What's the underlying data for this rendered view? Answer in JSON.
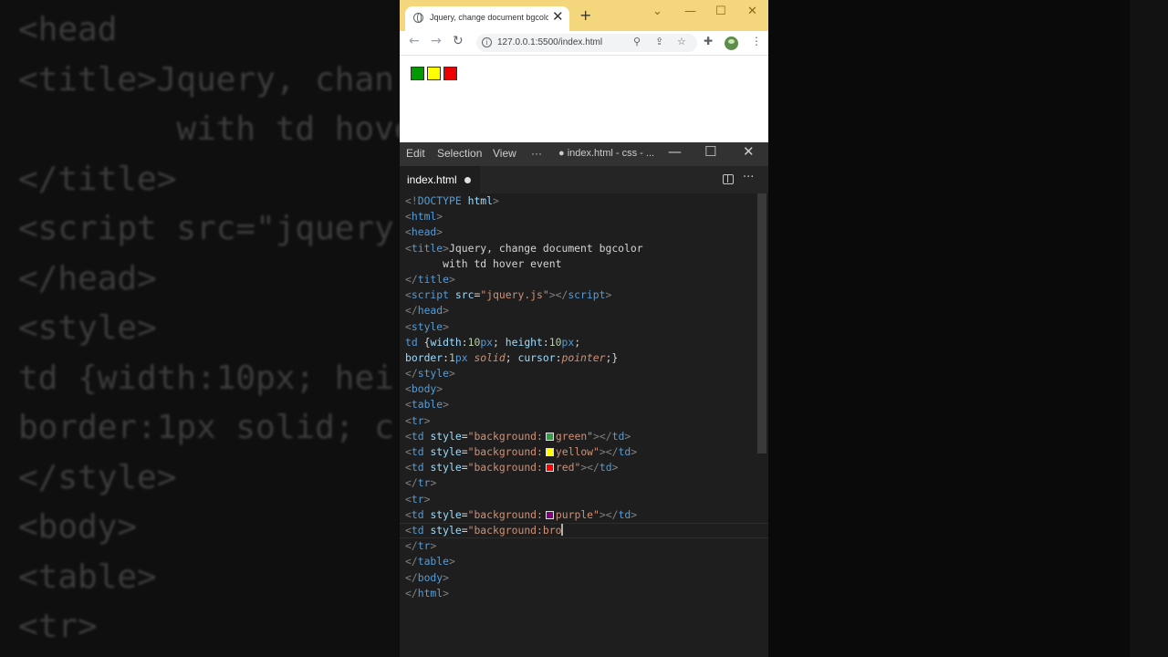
{
  "background_code": {
    "lines": [
      "<head",
      "<title>Jquery, chan",
      "        with td hove",
      "</title>",
      "<script src=\"jquery",
      "</head>",
      "<style>",
      "td {width:10px; hei",
      "border:1px solid; c",
      "</style>",
      "<body>",
      "<table>",
      "<tr>"
    ]
  },
  "browser": {
    "tab_title": "Jquery, change document bgcolo",
    "tab_close": "✕",
    "new_tab": "+",
    "url": "127.0.0.1:5500/index.html",
    "cells": [
      {
        "color": "#009900"
      },
      {
        "color": "#ffff00"
      },
      {
        "color": "#ee0000"
      }
    ]
  },
  "vscode": {
    "menu": {
      "edit": "Edit",
      "selection": "Selection",
      "view": "View",
      "more": "···"
    },
    "window_title": "● index.html - css - ...",
    "tab": {
      "name": "index.html"
    },
    "code": [
      {
        "indent": "",
        "toks": [
          [
            "tg",
            "<!"
          ],
          [
            "tn",
            "DOCTYPE"
          ],
          [
            "tx",
            " "
          ],
          [
            "at",
            "html"
          ],
          [
            "tg",
            ">"
          ]
        ]
      },
      {
        "indent": "",
        "toks": [
          [
            "tg",
            "<"
          ],
          [
            "tn",
            "html"
          ],
          [
            "tg",
            ">"
          ]
        ]
      },
      {
        "indent": "",
        "toks": [
          [
            "tg",
            "<"
          ],
          [
            "tn",
            "head"
          ],
          [
            "tg",
            ">"
          ]
        ]
      },
      {
        "indent": "",
        "toks": [
          [
            "tg",
            "<"
          ],
          [
            "tn",
            "title"
          ],
          [
            "tg",
            ">"
          ],
          [
            "tx",
            "Jquery, change document bgcolor"
          ]
        ]
      },
      {
        "indent": "      ",
        "toks": [
          [
            "tx",
            "with td hover event"
          ]
        ]
      },
      {
        "indent": "",
        "toks": [
          [
            "tg",
            "</"
          ],
          [
            "tn",
            "title"
          ],
          [
            "tg",
            ">"
          ]
        ]
      },
      {
        "indent": "",
        "toks": [
          [
            "tg",
            "<"
          ],
          [
            "tn",
            "script"
          ],
          [
            "tx",
            " "
          ],
          [
            "at",
            "src"
          ],
          [
            "tx",
            "="
          ],
          [
            "st",
            "\"jquery.js\""
          ],
          [
            "tg",
            "></"
          ],
          [
            "tn",
            "script"
          ],
          [
            "tg",
            ">"
          ]
        ]
      },
      {
        "indent": "",
        "toks": [
          [
            "tg",
            "</"
          ],
          [
            "tn",
            "head"
          ],
          [
            "tg",
            ">"
          ]
        ]
      },
      {
        "indent": "",
        "toks": [
          [
            "tg",
            "<"
          ],
          [
            "tn",
            "style"
          ],
          [
            "tg",
            ">"
          ]
        ]
      },
      {
        "indent": "",
        "toks": [
          [
            "tn",
            "td"
          ],
          [
            "tx",
            " {"
          ],
          [
            "pr",
            "width"
          ],
          [
            "tx",
            ":"
          ],
          [
            "nm",
            "10"
          ],
          [
            "un",
            "px"
          ],
          [
            "tx",
            "; "
          ],
          [
            "pr",
            "height"
          ],
          [
            "tx",
            ":"
          ],
          [
            "nm",
            "10"
          ],
          [
            "un",
            "px"
          ],
          [
            "tx",
            ";"
          ]
        ]
      },
      {
        "indent": "",
        "toks": [
          [
            "pr",
            "border"
          ],
          [
            "tx",
            ":"
          ],
          [
            "nm",
            "1"
          ],
          [
            "un",
            "px"
          ],
          [
            "tx",
            " "
          ],
          [
            "kw",
            "solid"
          ],
          [
            "tx",
            "; "
          ],
          [
            "pr",
            "cursor"
          ],
          [
            "tx",
            ":"
          ],
          [
            "kw",
            "pointer"
          ],
          [
            "tx",
            ";}"
          ]
        ]
      },
      {
        "indent": "",
        "toks": [
          [
            "tg",
            "</"
          ],
          [
            "tn",
            "style"
          ],
          [
            "tg",
            ">"
          ]
        ]
      },
      {
        "indent": "",
        "toks": [
          [
            "tg",
            "<"
          ],
          [
            "tn",
            "body"
          ],
          [
            "tg",
            ">"
          ]
        ]
      },
      {
        "indent": "",
        "toks": [
          [
            "tg",
            "<"
          ],
          [
            "tn",
            "table"
          ],
          [
            "tg",
            ">"
          ]
        ]
      },
      {
        "indent": "",
        "toks": [
          [
            "tg",
            "<"
          ],
          [
            "tn",
            "tr"
          ],
          [
            "tg",
            ">"
          ]
        ]
      },
      {
        "indent": "",
        "toks": [
          [
            "tg",
            "<"
          ],
          [
            "tn",
            "td"
          ],
          [
            "tx",
            " "
          ],
          [
            "at",
            "style"
          ],
          [
            "tx",
            "="
          ],
          [
            "st",
            "\"background:"
          ],
          [
            "sw",
            "#2ea043"
          ],
          [
            "st",
            "green\""
          ],
          [
            "tg",
            "></"
          ],
          [
            "tn",
            "td"
          ],
          [
            "tg",
            ">"
          ]
        ]
      },
      {
        "indent": "",
        "toks": [
          [
            "tg",
            "<"
          ],
          [
            "tn",
            "td"
          ],
          [
            "tx",
            " "
          ],
          [
            "at",
            "style"
          ],
          [
            "tx",
            "="
          ],
          [
            "st",
            "\"background:"
          ],
          [
            "sw",
            "#ffff00"
          ],
          [
            "st",
            "yellow\""
          ],
          [
            "tg",
            "></"
          ],
          [
            "tn",
            "td"
          ],
          [
            "tg",
            ">"
          ]
        ]
      },
      {
        "indent": "",
        "toks": [
          [
            "tg",
            "<"
          ],
          [
            "tn",
            "td"
          ],
          [
            "tx",
            " "
          ],
          [
            "at",
            "style"
          ],
          [
            "tx",
            "="
          ],
          [
            "st",
            "\"background:"
          ],
          [
            "sw",
            "#ff0000"
          ],
          [
            "st",
            "red\""
          ],
          [
            "tg",
            "></"
          ],
          [
            "tn",
            "td"
          ],
          [
            "tg",
            ">"
          ]
        ]
      },
      {
        "indent": "",
        "toks": [
          [
            "tg",
            "</"
          ],
          [
            "tn",
            "tr"
          ],
          [
            "tg",
            ">"
          ]
        ]
      },
      {
        "indent": "",
        "toks": [
          [
            "tg",
            "<"
          ],
          [
            "tn",
            "tr"
          ],
          [
            "tg",
            ">"
          ]
        ]
      },
      {
        "indent": "",
        "toks": [
          [
            "tg",
            "<"
          ],
          [
            "tn",
            "td"
          ],
          [
            "tx",
            " "
          ],
          [
            "at",
            "style"
          ],
          [
            "tx",
            "="
          ],
          [
            "st",
            "\"background:"
          ],
          [
            "sw",
            "#800080"
          ],
          [
            "st",
            "purple\""
          ],
          [
            "tg",
            "></"
          ],
          [
            "tn",
            "td"
          ],
          [
            "tg",
            ">"
          ]
        ]
      },
      {
        "indent": "",
        "toks": [
          [
            "tg",
            "<"
          ],
          [
            "tn",
            "td"
          ],
          [
            "tx",
            " "
          ],
          [
            "at",
            "style"
          ],
          [
            "tx",
            "="
          ],
          [
            "st",
            "\"background:bro"
          ],
          [
            "cur",
            ""
          ]
        ]
      },
      {
        "indent": "",
        "toks": [
          [
            "tg",
            "</"
          ],
          [
            "tn",
            "tr"
          ],
          [
            "tg",
            ">"
          ]
        ]
      },
      {
        "indent": "",
        "toks": [
          [
            "tg",
            "</"
          ],
          [
            "tn",
            "table"
          ],
          [
            "tg",
            ">"
          ]
        ]
      },
      {
        "indent": "",
        "toks": [
          [
            "tg",
            "</"
          ],
          [
            "tn",
            "body"
          ],
          [
            "tg",
            ">"
          ]
        ]
      },
      {
        "indent": "",
        "toks": [
          [
            "tg",
            "</"
          ],
          [
            "tn",
            "html"
          ],
          [
            "tg",
            ">"
          ]
        ]
      }
    ]
  }
}
